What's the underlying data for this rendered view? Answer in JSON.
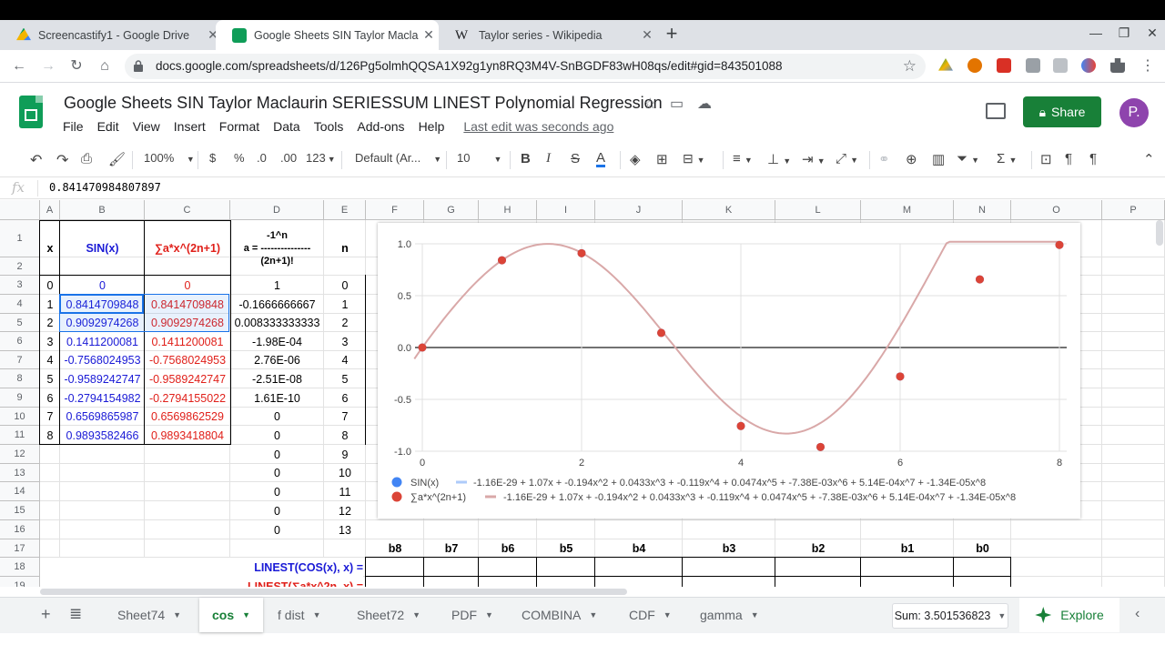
{
  "browser": {
    "tabs": [
      {
        "title": "Screencastify1 - Google Drive",
        "favicon_color": "#4285f4"
      },
      {
        "title": "Google Sheets SIN Taylor Maclau",
        "favicon_color": "#0f9d58"
      },
      {
        "title": "Taylor series - Wikipedia",
        "favicon_color": "#ffffff"
      }
    ],
    "url": "docs.google.com/spreadsheets/d/126Pg5olmhQQSA1X92g1yn8RQ3M4V-SnBGDF83wH08qs/edit#gid=843501088"
  },
  "doc": {
    "title": "Google Sheets SIN Taylor Maclaurin SERIESSUM LINEST Polynomial Regression",
    "menu": [
      "File",
      "Edit",
      "View",
      "Insert",
      "Format",
      "Data",
      "Tools",
      "Add-ons",
      "Help"
    ],
    "last_edit": "Last edit was seconds ago",
    "share_label": "Share",
    "avatar_letter": "P."
  },
  "toolbar": {
    "zoom": "100%",
    "currency": "$",
    "percent": "%",
    "dec_less": ".0",
    "dec_more": ".00",
    "more_formats": "123",
    "font": "Default (Ar...",
    "font_size": "10",
    "bold": "B",
    "italic": "I",
    "strike": "S",
    "text_color": "A"
  },
  "formula_bar": {
    "fx": "fx",
    "value": "0.841470984807897"
  },
  "grid": {
    "columns": [
      "A",
      "B",
      "C",
      "D",
      "E",
      "F",
      "G",
      "H",
      "I",
      "J",
      "K",
      "L",
      "M",
      "N",
      "O",
      "P"
    ],
    "rows": [
      "1",
      "2",
      "3",
      "4",
      "5",
      "6",
      "7",
      "8",
      "9",
      "10",
      "11",
      "12",
      "13",
      "14",
      "15",
      "16",
      "17",
      "18",
      "19"
    ],
    "header": {
      "x": "x",
      "sin": "SIN(x)",
      "sum": "∑a*x^(2n+1)",
      "a_line1": "-1^n",
      "a_line2": "a = ---------------",
      "a_line3": "(2n+1)!",
      "n": "n"
    },
    "col_a": [
      "0",
      "1",
      "2",
      "3",
      "4",
      "5",
      "6",
      "7",
      "8"
    ],
    "col_b": [
      "0",
      "0.8414709848",
      "0.9092974268",
      "0.1411200081",
      "-0.7568024953",
      "-0.9589242747",
      "-0.2794154982",
      "0.6569865987",
      "0.9893582466"
    ],
    "col_c": [
      "0",
      "0.8414709848",
      "0.9092974268",
      "0.1411200081",
      "-0.7568024953",
      "-0.9589242747",
      "-0.2794155022",
      "0.6569862529",
      "0.9893418804"
    ],
    "col_d": [
      "1",
      "-0.1666666667",
      "0.008333333333",
      "-1.98E-04",
      "2.76E-06",
      "-2.51E-08",
      "1.61E-10",
      "0",
      "0",
      "0",
      "0",
      "0",
      "0",
      "0"
    ],
    "col_e": [
      "0",
      "1",
      "2",
      "3",
      "4",
      "5",
      "6",
      "7",
      "8",
      "9",
      "10",
      "11",
      "12",
      "13"
    ],
    "coef_headers": [
      "b8",
      "b7",
      "b6",
      "b5",
      "b4",
      "b3",
      "b2",
      "b1",
      "b0"
    ],
    "linest_cos": "LINEST(COS(x), x) =",
    "linest_sum": "LINEST(∑a*x^2n, x) ="
  },
  "chart_data": {
    "type": "scatter",
    "title": "",
    "xlabel": "",
    "ylabel": "",
    "xlim": [
      0,
      8
    ],
    "ylim": [
      -1.0,
      1.0
    ],
    "x_ticks": [
      "0",
      "2",
      "4",
      "6",
      "8"
    ],
    "y_ticks": [
      "1.0",
      "0.5",
      "0.0",
      "-0.5",
      "-1.0"
    ],
    "grid": true,
    "legend_position": "bottom",
    "x": [
      0,
      1,
      2,
      3,
      4,
      5,
      6,
      7,
      8
    ],
    "series": [
      {
        "name": "SIN(x)",
        "color": "#4285f4",
        "values": [
          0,
          0.8414709848,
          0.9092974268,
          0.1411200081,
          -0.7568024953,
          -0.9589242747,
          -0.2794154982,
          0.6569865987,
          0.9893582466
        ]
      },
      {
        "name": "∑a*x^(2n+1)",
        "color": "#db4437",
        "values": [
          0,
          0.8414709848,
          0.9092974268,
          0.1411200081,
          -0.7568024953,
          -0.9589242747,
          -0.2794155022,
          0.6569862529,
          0.9893418804
        ]
      }
    ],
    "trendline_color": "#d9a8a8",
    "trendline_coefficients": [
      -1.16e-29,
      1.07,
      -0.194,
      0.0433,
      -0.119,
      0.0474,
      -0.00738,
      0.000514,
      -1.34e-05
    ],
    "trendline_labels": [
      "-1.16E-29 + 1.07x + -0.194x^2 + 0.0433x^3 + -0.119x^4 + 0.0474x^5 + -7.38E-03x^6 + 5.14E-04x^7 + -1.34E-05x^8",
      "-1.16E-29 + 1.07x + -0.194x^2 + 0.0433x^3 + -0.119x^4 + 0.0474x^5 + -7.38E-03x^6 + 5.14E-04x^7 + -1.34E-05x^8"
    ]
  },
  "sheets": {
    "tabs": [
      "Sheet74",
      "cos",
      "f dist",
      "Sheet72",
      "PDF",
      "COMBINA",
      "CDF",
      "gamma"
    ],
    "active": "cos",
    "sum": "Sum: 3.501536823",
    "explore": "Explore"
  }
}
